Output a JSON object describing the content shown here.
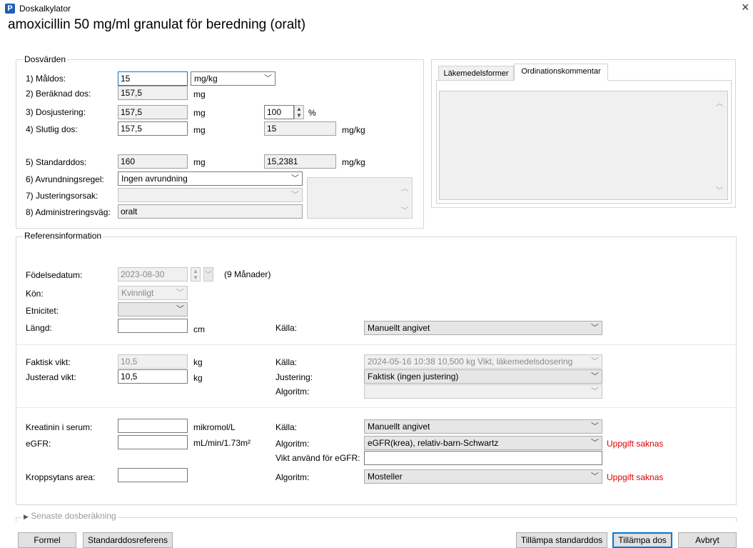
{
  "window": {
    "title": "Doskalkylator",
    "app_icon_letter": "P",
    "close_glyph": "×"
  },
  "drug_title": "amoxicillin 50 mg/ml granulat för beredning (oralt)",
  "dosvarden": {
    "title": "Dosvärden",
    "maldos": {
      "label": "1) Måldos:",
      "value": "15",
      "unit": "mg/kg"
    },
    "beraknad": {
      "label": "2) Beräknad dos:",
      "value": "157,5",
      "unit": "mg"
    },
    "dosjustering": {
      "label": "3) Dosjustering:",
      "value": "157,5",
      "unit": "mg",
      "percent": "100",
      "percent_sign": "%"
    },
    "slutlig": {
      "label": "4) Slutlig dos:",
      "value": "157,5",
      "unit": "mg",
      "perkg": "15",
      "perkg_unit": "mg/kg"
    },
    "standard": {
      "label": "5) Standarddos:",
      "value": "160",
      "unit": "mg",
      "perkg": "15,2381",
      "perkg_unit": "mg/kg"
    },
    "avrundning": {
      "label": "6) Avrundningsregel:",
      "value": "Ingen avrundning"
    },
    "justeringsorsak": {
      "label": "7) Justeringsorsak:",
      "value": ""
    },
    "admin": {
      "label": "8) Administreringsväg:",
      "value": "oralt"
    }
  },
  "tabs": [
    {
      "label": "Läkemedelsformer"
    },
    {
      "label": "Ordinationskommentar"
    }
  ],
  "ref": {
    "title": "Referensinformation",
    "fodelse": {
      "label": "Födelsedatum:",
      "value": "2023-08-30",
      "age": "(9 Månader)"
    },
    "kon": {
      "label": "Kön:",
      "value": "Kvinnligt"
    },
    "etnicitet": {
      "label": "Etnicitet:",
      "value": ""
    },
    "langd": {
      "label": "Längd:",
      "value": "",
      "unit": "cm",
      "source_label": "Källa:",
      "source": "Manuellt angivet"
    },
    "faktisk_vikt": {
      "label": "Faktisk vikt:",
      "value": "10,5",
      "unit": "kg",
      "source_label": "Källa:",
      "source": "2024-05-16 10:38   10,500 kg Vikt, läkemedelsdosering"
    },
    "justerad_vikt": {
      "label": "Justerad vikt:",
      "value": "10,5",
      "unit": "kg",
      "adj_label": "Justering:",
      "adj": "Faktisk (ingen justering)",
      "alg_label": "Algoritm:",
      "alg": ""
    },
    "kreatinin": {
      "label": "Kreatinin i serum:",
      "value": "",
      "unit": "mikromol/L",
      "source_label": "Källa:",
      "source": "Manuellt angivet"
    },
    "egfr": {
      "label": "eGFR:",
      "value": "",
      "unit": "mL/min/1.73m²",
      "alg_label": "Algoritm:",
      "alg": "eGFR(krea), relativ-barn-Schwartz",
      "missing": "Uppgift saknas",
      "weight_label": "Vikt använd för eGFR:",
      "weight": ""
    },
    "kroppsyta": {
      "label": "Kroppsytans area:",
      "value": "",
      "alg_label": "Algoritm:",
      "alg": "Mosteller",
      "missing": "Uppgift saknas"
    }
  },
  "senaste": {
    "label": "Senaste dosberäkning"
  },
  "buttons": {
    "formel": "Formel",
    "standardref": "Standarddosreferens",
    "tillampa_std": "Tillämpa standarddos",
    "tillampa": "Tillämpa dos",
    "avbryt": "Avbryt"
  }
}
